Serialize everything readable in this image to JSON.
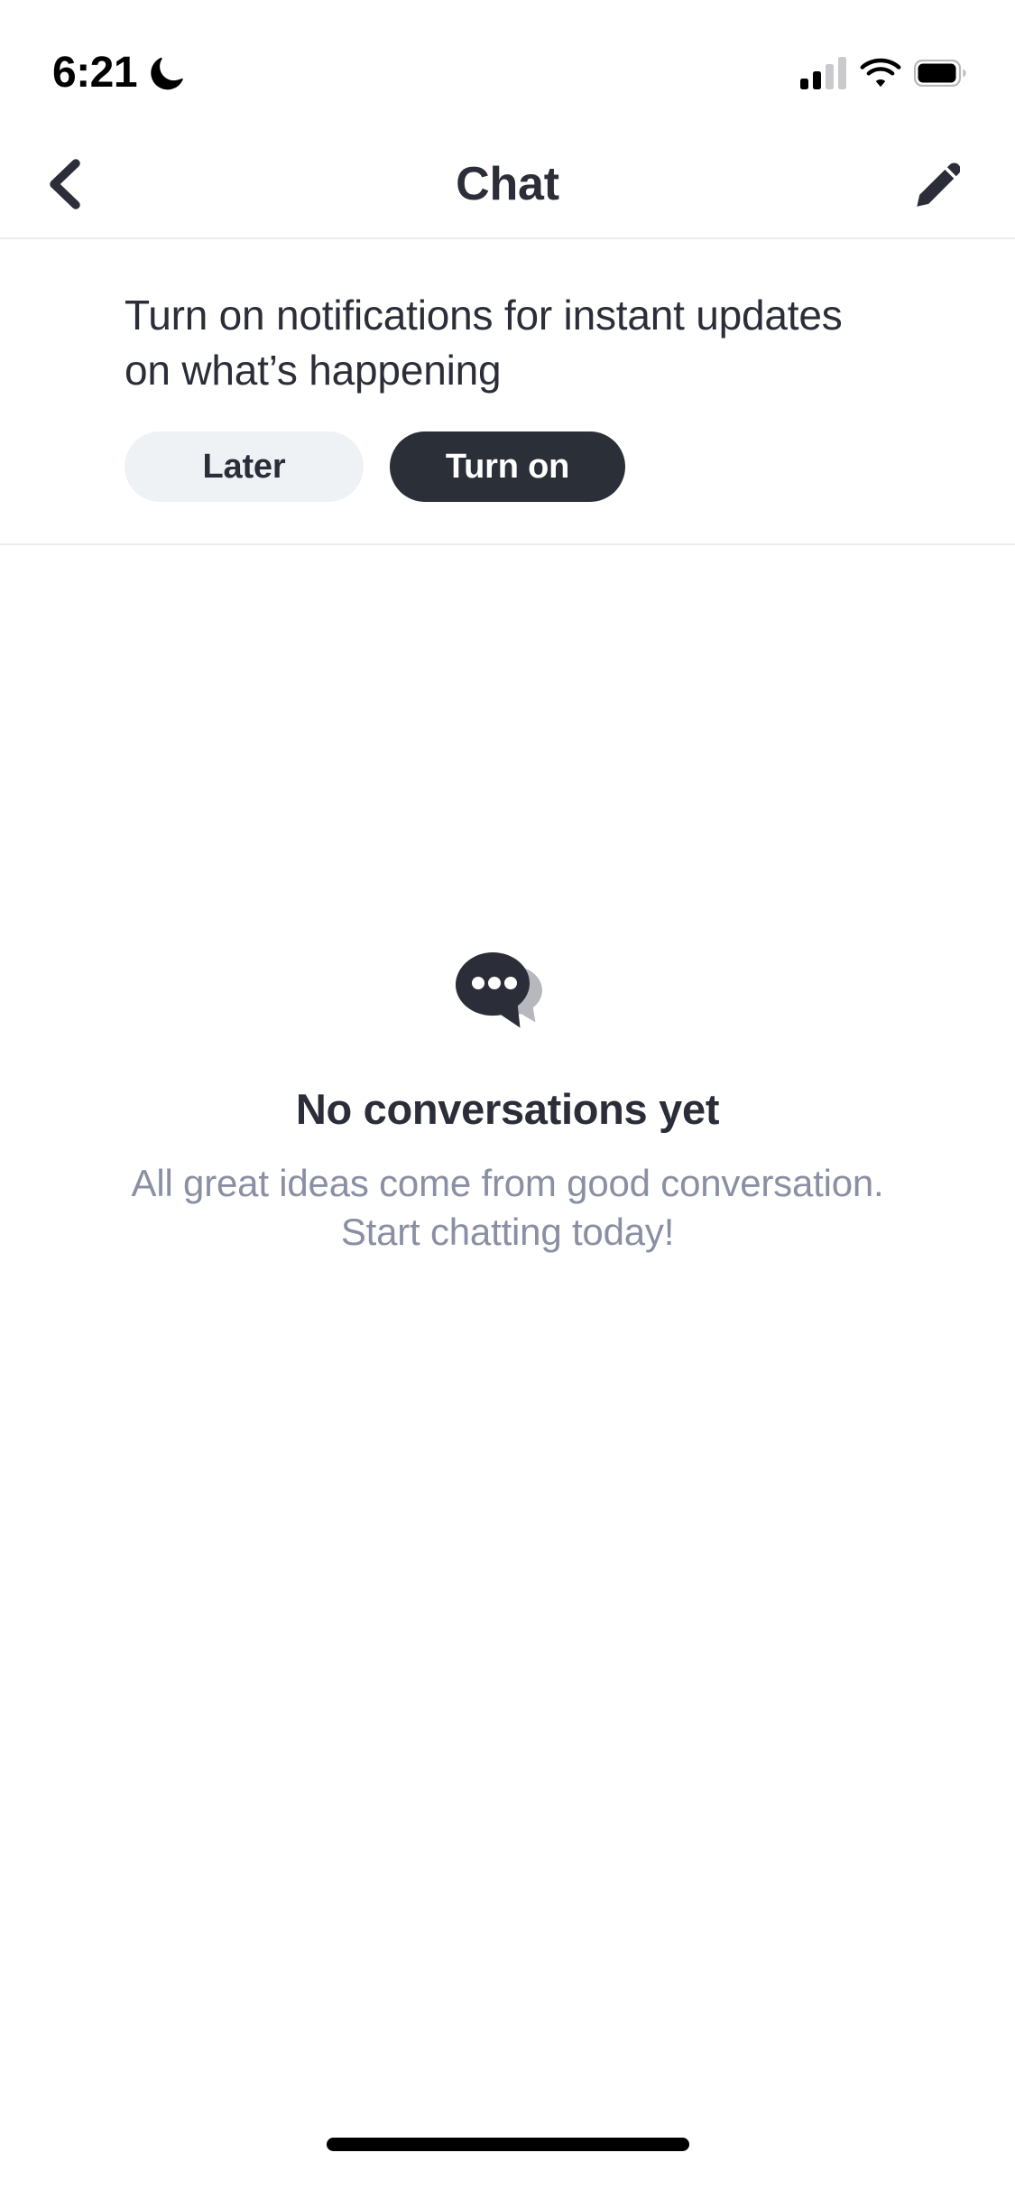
{
  "status_bar": {
    "time": "6:21",
    "icons": {
      "dnd": "crescent-moon-icon",
      "signal": "cellular-signal-icon",
      "wifi": "wifi-icon",
      "battery": "battery-icon"
    },
    "signal_bars_filled": 2,
    "signal_bars_total": 4
  },
  "nav_bar": {
    "title": "Chat",
    "back_icon": "chevron-left-icon",
    "compose_icon": "pencil-icon"
  },
  "notification_banner": {
    "message": "Turn on notifications for instant updates on what’s happening",
    "secondary_button": "Later",
    "primary_button": "Turn on"
  },
  "empty_state": {
    "illustration": "chat-bubbles-icon",
    "title": "No conversations yet",
    "subtitle": "All great ideas come from good conversation. Start chatting today!"
  },
  "home_indicator": "home-indicator-bar",
  "colors": {
    "text_primary": "#2b2e38",
    "text_muted": "#8a8fa3",
    "button_primary_bg": "#2b2f38",
    "button_primary_text": "#ffffff",
    "button_secondary_bg": "#eff2f5",
    "divider": "#ececf0",
    "bubble_dark": "#2b2e38",
    "bubble_light": "#b6b8bd",
    "background": "#ffffff"
  }
}
